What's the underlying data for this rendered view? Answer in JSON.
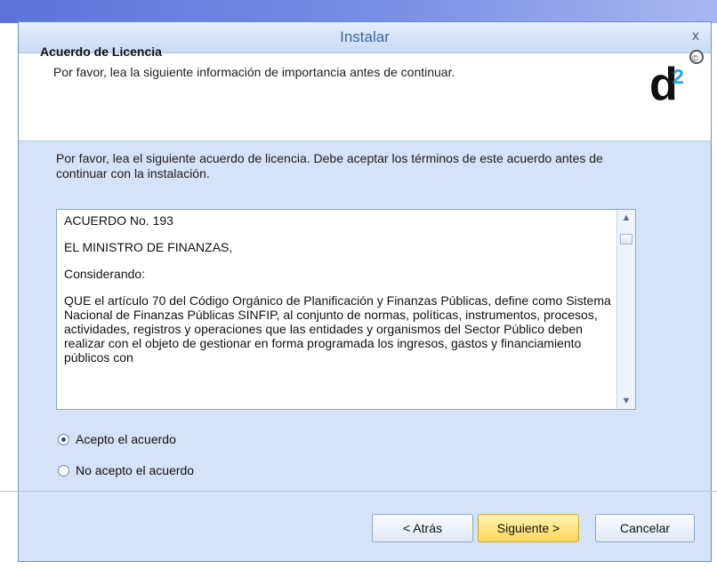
{
  "window": {
    "title": "Instalar",
    "close_label": "x"
  },
  "header": {
    "title": "Acuerdo de Licencia",
    "subtitle": "Por favor, lea la siguiente información de importancia antes de continuar."
  },
  "logo": {
    "main_text": "d",
    "badge_text": "2",
    "symbol": "©"
  },
  "intro_text": "Por favor, lea el siguiente acuerdo de licencia. Debe aceptar los términos de este acuerdo antes de continuar con la instalación.",
  "license": {
    "lines": [
      "ACUERDO No. 193",
      "EL MINISTRO DE FINANZAS,",
      "Considerando:",
      "QUE        el artículo 70 del Código Orgánico de Planificación y Finanzas Públicas, define como Sistema Nacional de Finanzas Públicas SINFIP, al conjunto de normas, políticas, instrumentos, procesos, actividades, registros y operaciones que las entidades y organismos del Sector Público deben realizar con el objeto de gestionar en forma programada los ingresos, gastos y financiamiento públicos con"
    ]
  },
  "options": {
    "accept": "Acepto el acuerdo",
    "reject": "No acepto el acuerdo",
    "selected": "accept"
  },
  "buttons": {
    "back": "< Atrás",
    "next": "Siguiente >",
    "cancel": "Cancelar"
  }
}
